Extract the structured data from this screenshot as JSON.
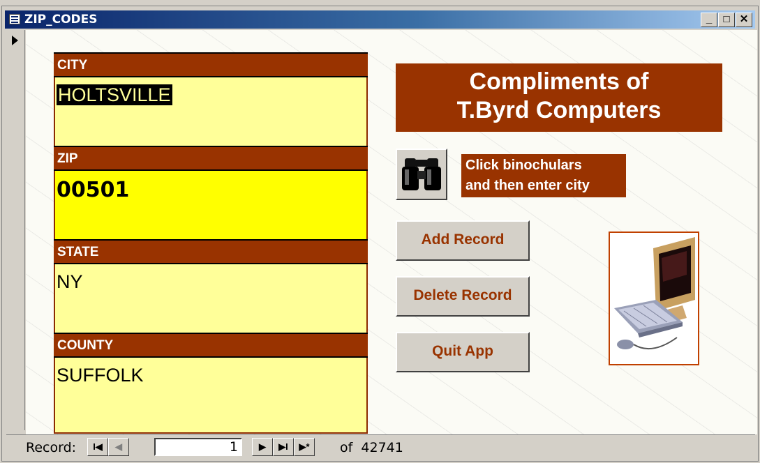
{
  "window": {
    "title": "ZIP_CODES"
  },
  "controls": {
    "minimize": "_",
    "maximize": "□",
    "close": "✕"
  },
  "fields": {
    "city": {
      "label": "CITY",
      "value": "HOLTSVILLE"
    },
    "zip": {
      "label": "ZIP",
      "value": "00501"
    },
    "state": {
      "label": "STATE",
      "value": "NY"
    },
    "county": {
      "label": "COUNTY",
      "value": "SUFFOLK"
    }
  },
  "banner": {
    "line1": "Compliments of",
    "line2": "T.Byrd Computers"
  },
  "hint": {
    "line1": "Click binochulars",
    "line2": "and then enter city"
  },
  "buttons": {
    "add": "Add Record",
    "delete": "Delete Record",
    "quit": "Quit App"
  },
  "icons": {
    "find": "binoculars-icon",
    "picture": "computer-clipart"
  },
  "navigation": {
    "label": "Record:",
    "current": "1",
    "of_label": "of",
    "total": "42741",
    "first": "I◀",
    "prev": "◀",
    "next": "▶",
    "last": "▶I",
    "new": "▶*"
  },
  "colors": {
    "label_bg": "#993300",
    "field_bg": "#ffff99",
    "zip_bg": "#ffff00"
  }
}
